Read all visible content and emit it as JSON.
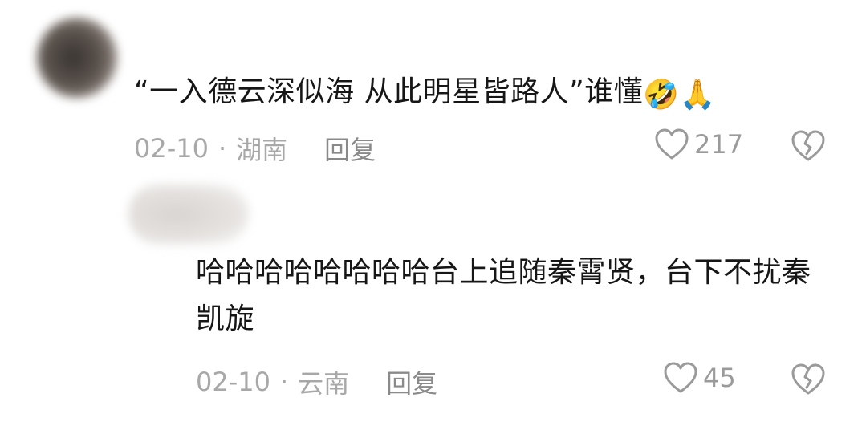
{
  "comments": [
    {
      "text": "“一入德云深似海 从此明星皆路人”谁懂",
      "emojis": [
        "rofl-emoji",
        "folded-hands-emoji"
      ],
      "date": "02-10",
      "location": "湖南",
      "reply_label": "回复",
      "likes": "217"
    },
    {
      "text": "哈哈哈哈哈哈哈哈台上追随秦霄贤，台下不扰秦凯旋",
      "date": "02-10",
      "location": "云南",
      "reply_label": "回复",
      "likes": "45"
    }
  ],
  "separator": "·",
  "colors": {
    "text": "#161616",
    "meta": "#a8a8a8",
    "icon": "#9a9a9a"
  }
}
